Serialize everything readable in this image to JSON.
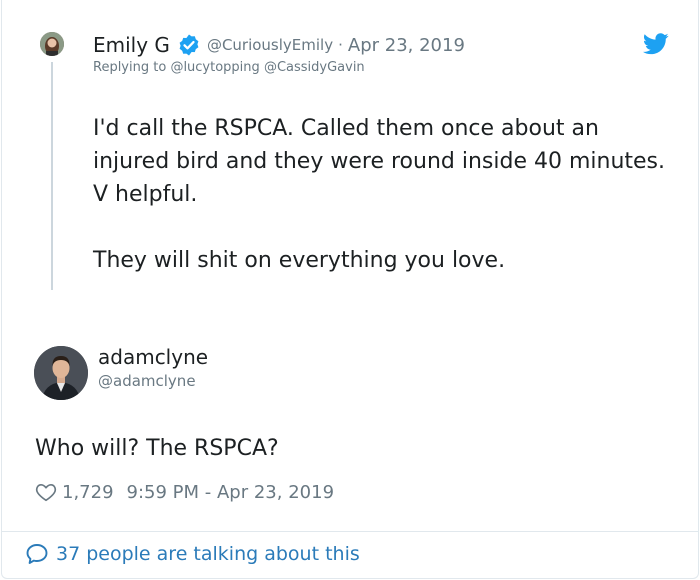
{
  "parent_tweet": {
    "name": "Emily G",
    "handle": "@CuriouslyEmily",
    "separator": "·",
    "date": "Apr 23, 2019",
    "reply_prefix": "Replying to",
    "reply_to": [
      "@lucytopping",
      "@CassidyGavin"
    ],
    "paragraphs": [
      "I'd call the RSPCA. Called them once about an injured bird and they were round inside 40 minutes. V helpful.",
      "They will shit on everything you love."
    ],
    "verified_icon": "verified-badge-icon"
  },
  "main_tweet": {
    "name": "adamclyne",
    "handle": "@adamclyne",
    "text": "Who will? The RSPCA?",
    "likes": "1,729",
    "timestamp": "9:59 PM - Apr 23, 2019"
  },
  "footer": {
    "talking_text": "37 people are talking about this"
  },
  "colors": {
    "twitter_blue": "#1da1f2",
    "link_blue": "#2b7bb9",
    "text_primary": "#1c2022",
    "text_secondary": "#697882",
    "border": "#e1e8ed",
    "thread_line": "#ccd6dd"
  },
  "icons": [
    "twitter-bird-icon",
    "verified-badge-icon",
    "heart-icon",
    "speech-bubble-icon"
  ]
}
